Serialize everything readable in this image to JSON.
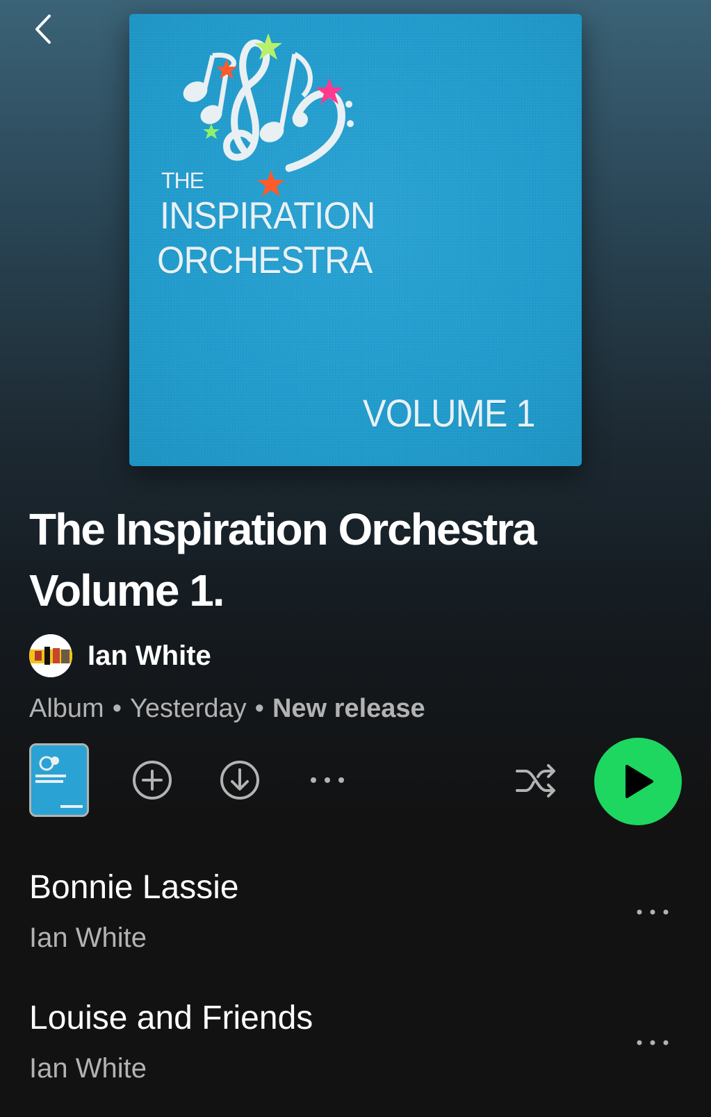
{
  "icons": {
    "back": "chevron-left-icon",
    "add": "plus-circle-icon",
    "download": "download-circle-icon",
    "more": "more-horizontal-icon",
    "shuffle": "shuffle-icon",
    "play": "play-icon"
  },
  "colors": {
    "background": "#121212",
    "accent": "#1ed760",
    "cover_blue": "#2aa3d4",
    "secondary_text": "#b3b3b3"
  },
  "cover": {
    "line1": "THE",
    "line2": "INSPIRATION",
    "line3": "ORCHESTRA",
    "volume": "VOLUME 1"
  },
  "album": {
    "title": "The Inspiration Orchestra Volume 1.",
    "artist": "Ian White",
    "type": "Album",
    "release": "Yesterday",
    "badge": "New release"
  },
  "tracks": [
    {
      "title": "Bonnie Lassie",
      "artist": "Ian White"
    },
    {
      "title": "Louise and Friends",
      "artist": "Ian White"
    }
  ]
}
